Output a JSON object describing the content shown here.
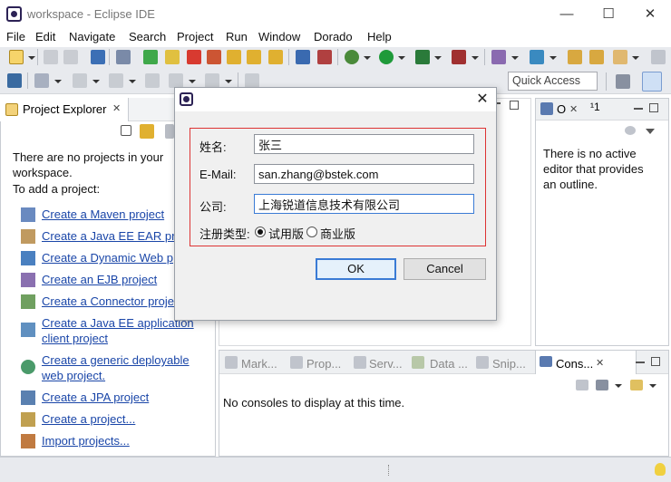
{
  "window": {
    "title": "workspace - Eclipse IDE",
    "minimize": "—",
    "maximize": "☐",
    "close": "✕"
  },
  "menubar": [
    "File",
    "Edit",
    "Navigate",
    "Search",
    "Project",
    "Run",
    "Window",
    "Dorado",
    "Help"
  ],
  "toolbar": {
    "quick_access": "Quick Access"
  },
  "project_explorer": {
    "tab_label": "Project Explorer",
    "tab_close": "✕",
    "messages": [
      "There are no projects in your",
      "workspace.",
      "To add a project:"
    ],
    "links": [
      [
        "Create a Maven project"
      ],
      [
        "Create a Java EE EAR pro"
      ],
      [
        "Create a Dynamic Web p"
      ],
      [
        "Create an EJB project"
      ],
      [
        "Create a Connector proje"
      ],
      [
        "Create a Java EE application",
        "client project"
      ],
      [
        "Create a generic deployable",
        "web project."
      ],
      [
        "Create a JPA project"
      ],
      [
        "Create a project..."
      ],
      [
        "Import projects..."
      ]
    ]
  },
  "outline": {
    "tab_label": "O",
    "tab_close": "✕",
    "overflow": "¹1",
    "message_lines": [
      "There is no active",
      "editor that provides",
      "an outline."
    ]
  },
  "bottom_panel": {
    "tabs": [
      "Mark...",
      "Prop...",
      "Serv...",
      "Data ...",
      "Snip...",
      "Cons..."
    ],
    "active_close": "✕",
    "message": "No consoles to display at this time."
  },
  "dialog": {
    "close": "✕",
    "fields": {
      "name_label": "姓名:",
      "name_value": "张三",
      "email_label": "E-Mail:",
      "email_value": "san.zhang@bstek.com",
      "company_label": "公司:",
      "company_value": "上海锐道信息技术有限公司"
    },
    "reg_label": "注册类型:",
    "reg_options": [
      "试用版",
      "商业版"
    ],
    "ok": "OK",
    "cancel": "Cancel"
  },
  "colors": {
    "accent": "#3a7bd5",
    "link": "#1a46a8",
    "form_border": "#dd3333"
  }
}
